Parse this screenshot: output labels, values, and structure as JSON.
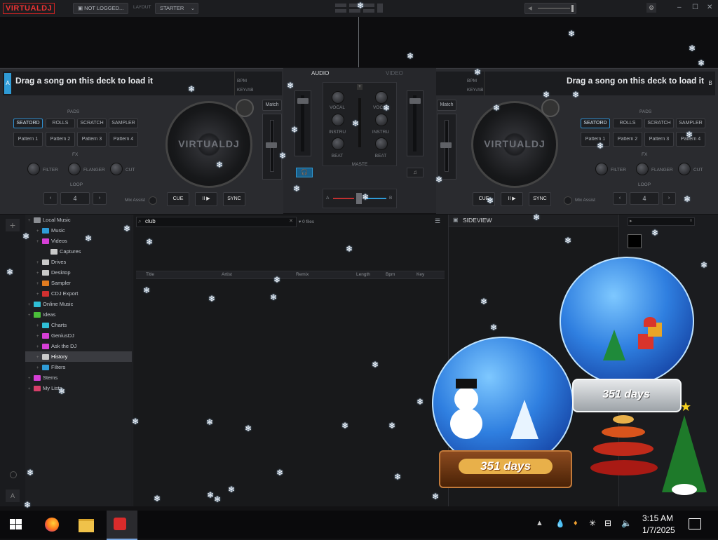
{
  "titlebar": {
    "logo": "VIRTUALDJ",
    "account": "NOT LOGGED...",
    "layout_label": "LAYOUT",
    "layout_value": "STARTER",
    "colors": {
      "logo": "#e33333",
      "deck_accent": "#2f9bd6"
    }
  },
  "deck_a": {
    "letter": "A",
    "song_title": "Drag a song on this deck to load it",
    "bpm_label": "BPM",
    "gain_label": "KEY/AB",
    "pads_label": "PADS",
    "pad_modes": [
      "SEATORD",
      "ROLLS",
      "SCRATCH",
      "SAMPLER"
    ],
    "pads": [
      "Pattern 1",
      "Pattern 2",
      "Pattern 3",
      "Pattern 4"
    ],
    "fx_label": "FX",
    "fx": [
      "FILTER",
      "FLANGER",
      "CUT"
    ],
    "loop_label": "LOOP",
    "loop_value": "4",
    "mix_assist": "Mix Assist",
    "match": "Match",
    "cue": "CUE",
    "play": "II ▶",
    "sync": "SYNC",
    "platter_logo": "VIRTUALDJ"
  },
  "deck_b": {
    "letter": "B",
    "song_title": "Drag a song on this deck to load it",
    "bpm_label": "BPM",
    "gain_label": "KEY/AB",
    "pads_label": "PADS",
    "pad_modes": [
      "SEATORD",
      "ROLLS",
      "SCRATCH",
      "SAMPLER"
    ],
    "pads": [
      "Pattern 1",
      "Pattern 2",
      "Pattern 3",
      "Pattern 4"
    ],
    "fx_label": "FX",
    "fx": [
      "FILTER",
      "FLANGER",
      "CUT"
    ],
    "loop_label": "LOOP",
    "loop_value": "4",
    "mix_assist": "Mix Assist",
    "match": "Match",
    "cue": "CUE",
    "play": "II ▶",
    "sync": "SYNC",
    "platter_logo": "VIRTUALDJ"
  },
  "mixer": {
    "tab_audio": "AUDIO",
    "tab_video": "VIDEO",
    "knob_labels": [
      "VOCAL",
      "INSTRU",
      "BEAT"
    ],
    "master_label": "MASTE",
    "crossfader_a": "A",
    "crossfader_b": "B"
  },
  "browser": {
    "search_value": "club",
    "file_count": "0 files",
    "tree": [
      {
        "label": "Local Music",
        "indent": 0,
        "color": "#8a8d92"
      },
      {
        "label": "Music",
        "indent": 1,
        "color": "#2f9bd6"
      },
      {
        "label": "Videos",
        "indent": 1,
        "color": "#d63fd6"
      },
      {
        "label": "Captures",
        "indent": 2,
        "color": "#c9c9c9"
      },
      {
        "label": "Drives",
        "indent": 1,
        "color": "#c9c9c9"
      },
      {
        "label": "Desktop",
        "indent": 1,
        "color": "#c9c9c9"
      },
      {
        "label": "Sampler",
        "indent": 1,
        "color": "#e07b20"
      },
      {
        "label": "CDJ Export",
        "indent": 1,
        "color": "#d03030"
      },
      {
        "label": "Online Music",
        "indent": 0,
        "color": "#2fbfd6"
      },
      {
        "label": "Ideas",
        "indent": 0,
        "color": "#4bbf3a"
      },
      {
        "label": "Charts",
        "indent": 1,
        "color": "#2fbfd6"
      },
      {
        "label": "GeniusDJ",
        "indent": 1,
        "color": "#d63fd6"
      },
      {
        "label": "Ask the DJ",
        "indent": 1,
        "color": "#d63fd6"
      },
      {
        "label": "History",
        "indent": 1,
        "color": "#c9c9c9",
        "selected": true
      },
      {
        "label": "Filters",
        "indent": 1,
        "color": "#2f9bd6"
      },
      {
        "label": "Stems",
        "indent": 0,
        "color": "#d63fd6"
      },
      {
        "label": "My Lists",
        "indent": 0,
        "color": "#d63f6a"
      }
    ],
    "columns": [
      "Title",
      "Artist",
      "Remix",
      "Length",
      "Bpm",
      "Key"
    ],
    "sideview_title": "SIDEVIEW"
  },
  "overlay": {
    "countdown_1": "351 days",
    "countdown_2": "351 days"
  },
  "taskbar": {
    "time": "3:15 AM",
    "date": "1/7/2025"
  }
}
